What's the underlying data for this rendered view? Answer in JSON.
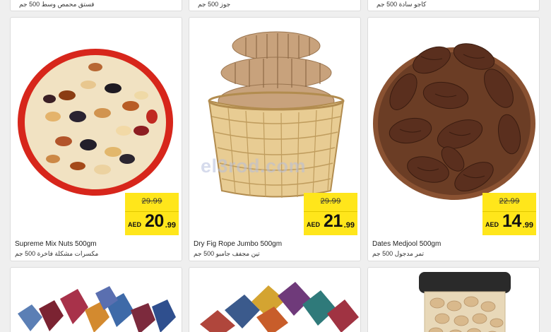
{
  "top_row": [
    {
      "arabic": "فستق محمص وسط 500 جم"
    },
    {
      "arabic": "جوز 500 جم"
    },
    {
      "arabic": "كاجو سادة 500 جم"
    }
  ],
  "products": [
    {
      "name": "Supreme Mix Nuts  500gm",
      "arabic": "مكسرات مشكلة فاخرة 500 جم",
      "old_price": "29.99",
      "currency": "AED",
      "price_main": "20",
      "price_frac": ".99"
    },
    {
      "name": "Dry Fig Rope Jumbo  500gm",
      "arabic": "تين مجفف جامبو 500 جم",
      "old_price": "29.99",
      "currency": "AED",
      "price_main": "21",
      "price_frac": ".99"
    },
    {
      "name": "Dates Medjool  500gm",
      "arabic": "تمر مدجول 500 جم",
      "old_price": "22.99",
      "currency": "AED",
      "price_main": "14",
      "price_frac": ".99"
    }
  ],
  "watermark": "el3rod.com",
  "colors": {
    "price_tag": "#ffe61b",
    "card_bg": "#ffffff",
    "page_bg": "#efefef"
  }
}
